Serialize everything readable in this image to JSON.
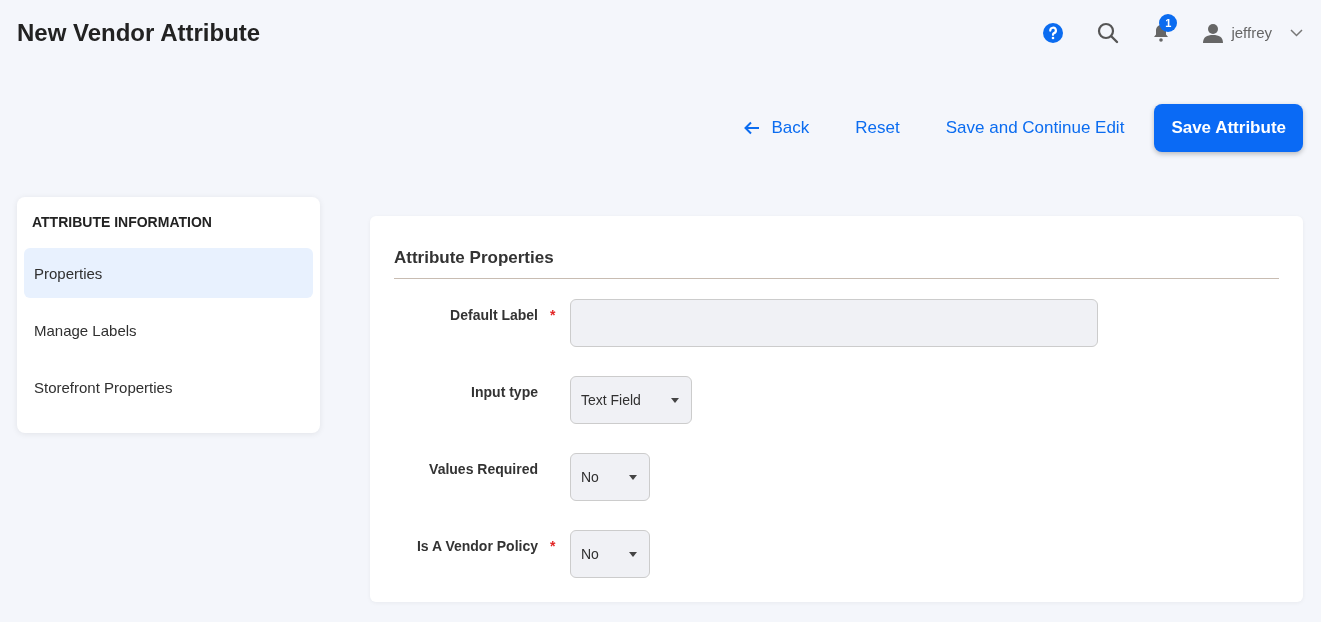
{
  "header": {
    "title": "New Vendor Attribute",
    "notification_count": "1",
    "user": "jeffrey"
  },
  "actions": [
    {
      "label": "Back",
      "kind": "back"
    },
    {
      "label": "Reset",
      "kind": "link"
    },
    {
      "label": "Save and Continue Edit",
      "kind": "link"
    },
    {
      "label": "Save Attribute",
      "kind": "primary"
    }
  ],
  "sidebar": {
    "title": "ATTRIBUTE INFORMATION",
    "items": [
      {
        "label": "Properties",
        "selected": true
      },
      {
        "label": "Manage Labels",
        "selected": false
      },
      {
        "label": "Storefront Properties",
        "selected": false
      }
    ]
  },
  "form": {
    "title": "Attribute Properties",
    "fields": [
      {
        "label": "Default Label",
        "required_mark": "*",
        "kind": "text"
      },
      {
        "label": "Input type",
        "kind": "select",
        "value": "Text Field"
      },
      {
        "label": "Values Required",
        "kind": "select",
        "value": "No"
      },
      {
        "label": "Is A Vendor Policy",
        "required_mark": "*",
        "kind": "select",
        "value": "No"
      }
    ]
  }
}
